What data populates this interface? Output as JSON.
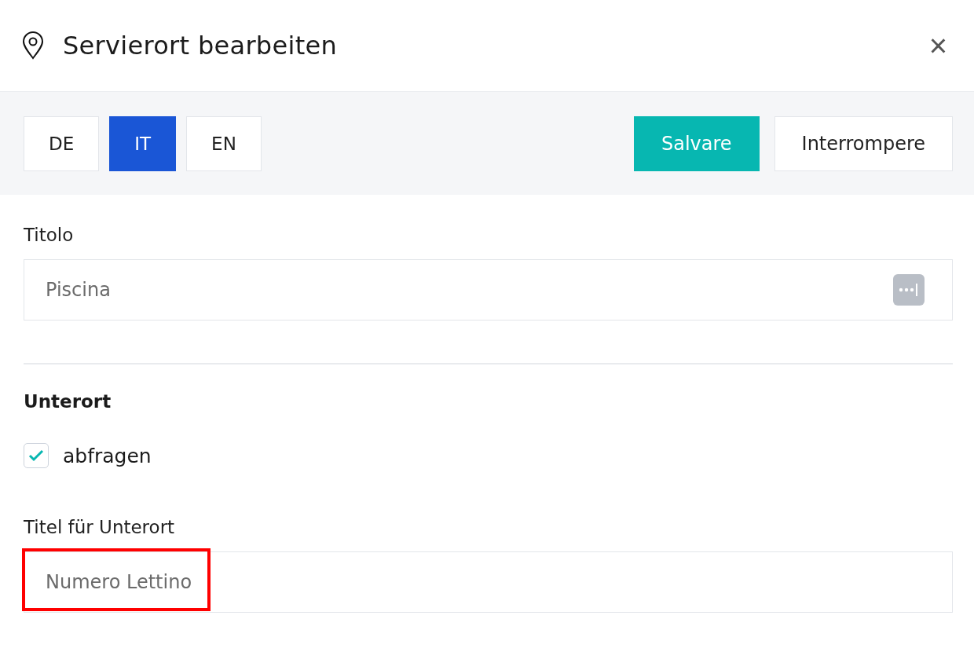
{
  "dialog": {
    "title": "Servierort bearbeiten",
    "close": "×"
  },
  "languages": [
    {
      "label": "DE",
      "selected": false
    },
    {
      "label": "IT",
      "selected": true
    },
    {
      "label": "EN",
      "selected": false
    }
  ],
  "actions": {
    "save": "Salvare",
    "cancel": "Interrompere"
  },
  "title_field": {
    "label": "Titolo",
    "placeholder": "Piscina"
  },
  "section": {
    "heading": "Unterort",
    "checkbox": {
      "label": "abfragen",
      "checked": true
    }
  },
  "sub_field": {
    "label": "Titel für Unterort",
    "placeholder": "Numero Lettino",
    "highlighted": true
  }
}
